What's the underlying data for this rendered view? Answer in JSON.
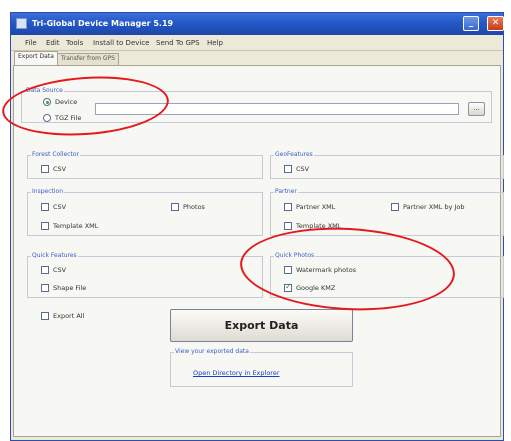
{
  "window": {
    "title": "Tri-Global Device Manager 5.19",
    "min_glyph": "_",
    "max_glyph": "□",
    "close_glyph": "✕"
  },
  "menu": [
    "File",
    "Edit",
    "Tools",
    "Install to Device",
    "Send To GPS",
    "Help"
  ],
  "tabs": [
    {
      "label": "Export Data",
      "active": true
    },
    {
      "label": "Transfer from GPS",
      "active": false
    }
  ],
  "data_source": {
    "title": "Data Source",
    "device_label": "Device",
    "tgz_label": "TGZ File",
    "selected": "Device",
    "path_value": "",
    "browse_label": "..."
  },
  "forest_collector": {
    "title": "Forest Collector",
    "csv": "CSV"
  },
  "geofeatures": {
    "title": "GeoFeatures",
    "csv": "CSV"
  },
  "inspection": {
    "title": "Inspection",
    "csv": "CSV",
    "photos": "Photos",
    "template_xml": "Template XML"
  },
  "partner": {
    "title": "Partner",
    "partner_xml": "Partner XML",
    "partner_xml_by_job": "Partner XML by Job",
    "template_xml": "Template XML"
  },
  "quick_features": {
    "title": "Quick Features",
    "csv": "CSV",
    "shape_file": "Shape File"
  },
  "quick_photos": {
    "title": "Quick Photos",
    "watermark": "Watermark photos",
    "google_kmz": "Google KMZ",
    "google_kmz_checked": true
  },
  "export_all": "Export All",
  "export_button": "Export Data",
  "exported": {
    "title": "View your exported data",
    "link": "Open Directory in Explorer"
  },
  "colors": {
    "annotation": "#e4191b",
    "titlebar": "#2458c8",
    "group_title": "#3a5fc8",
    "link": "#1a3cc8"
  }
}
